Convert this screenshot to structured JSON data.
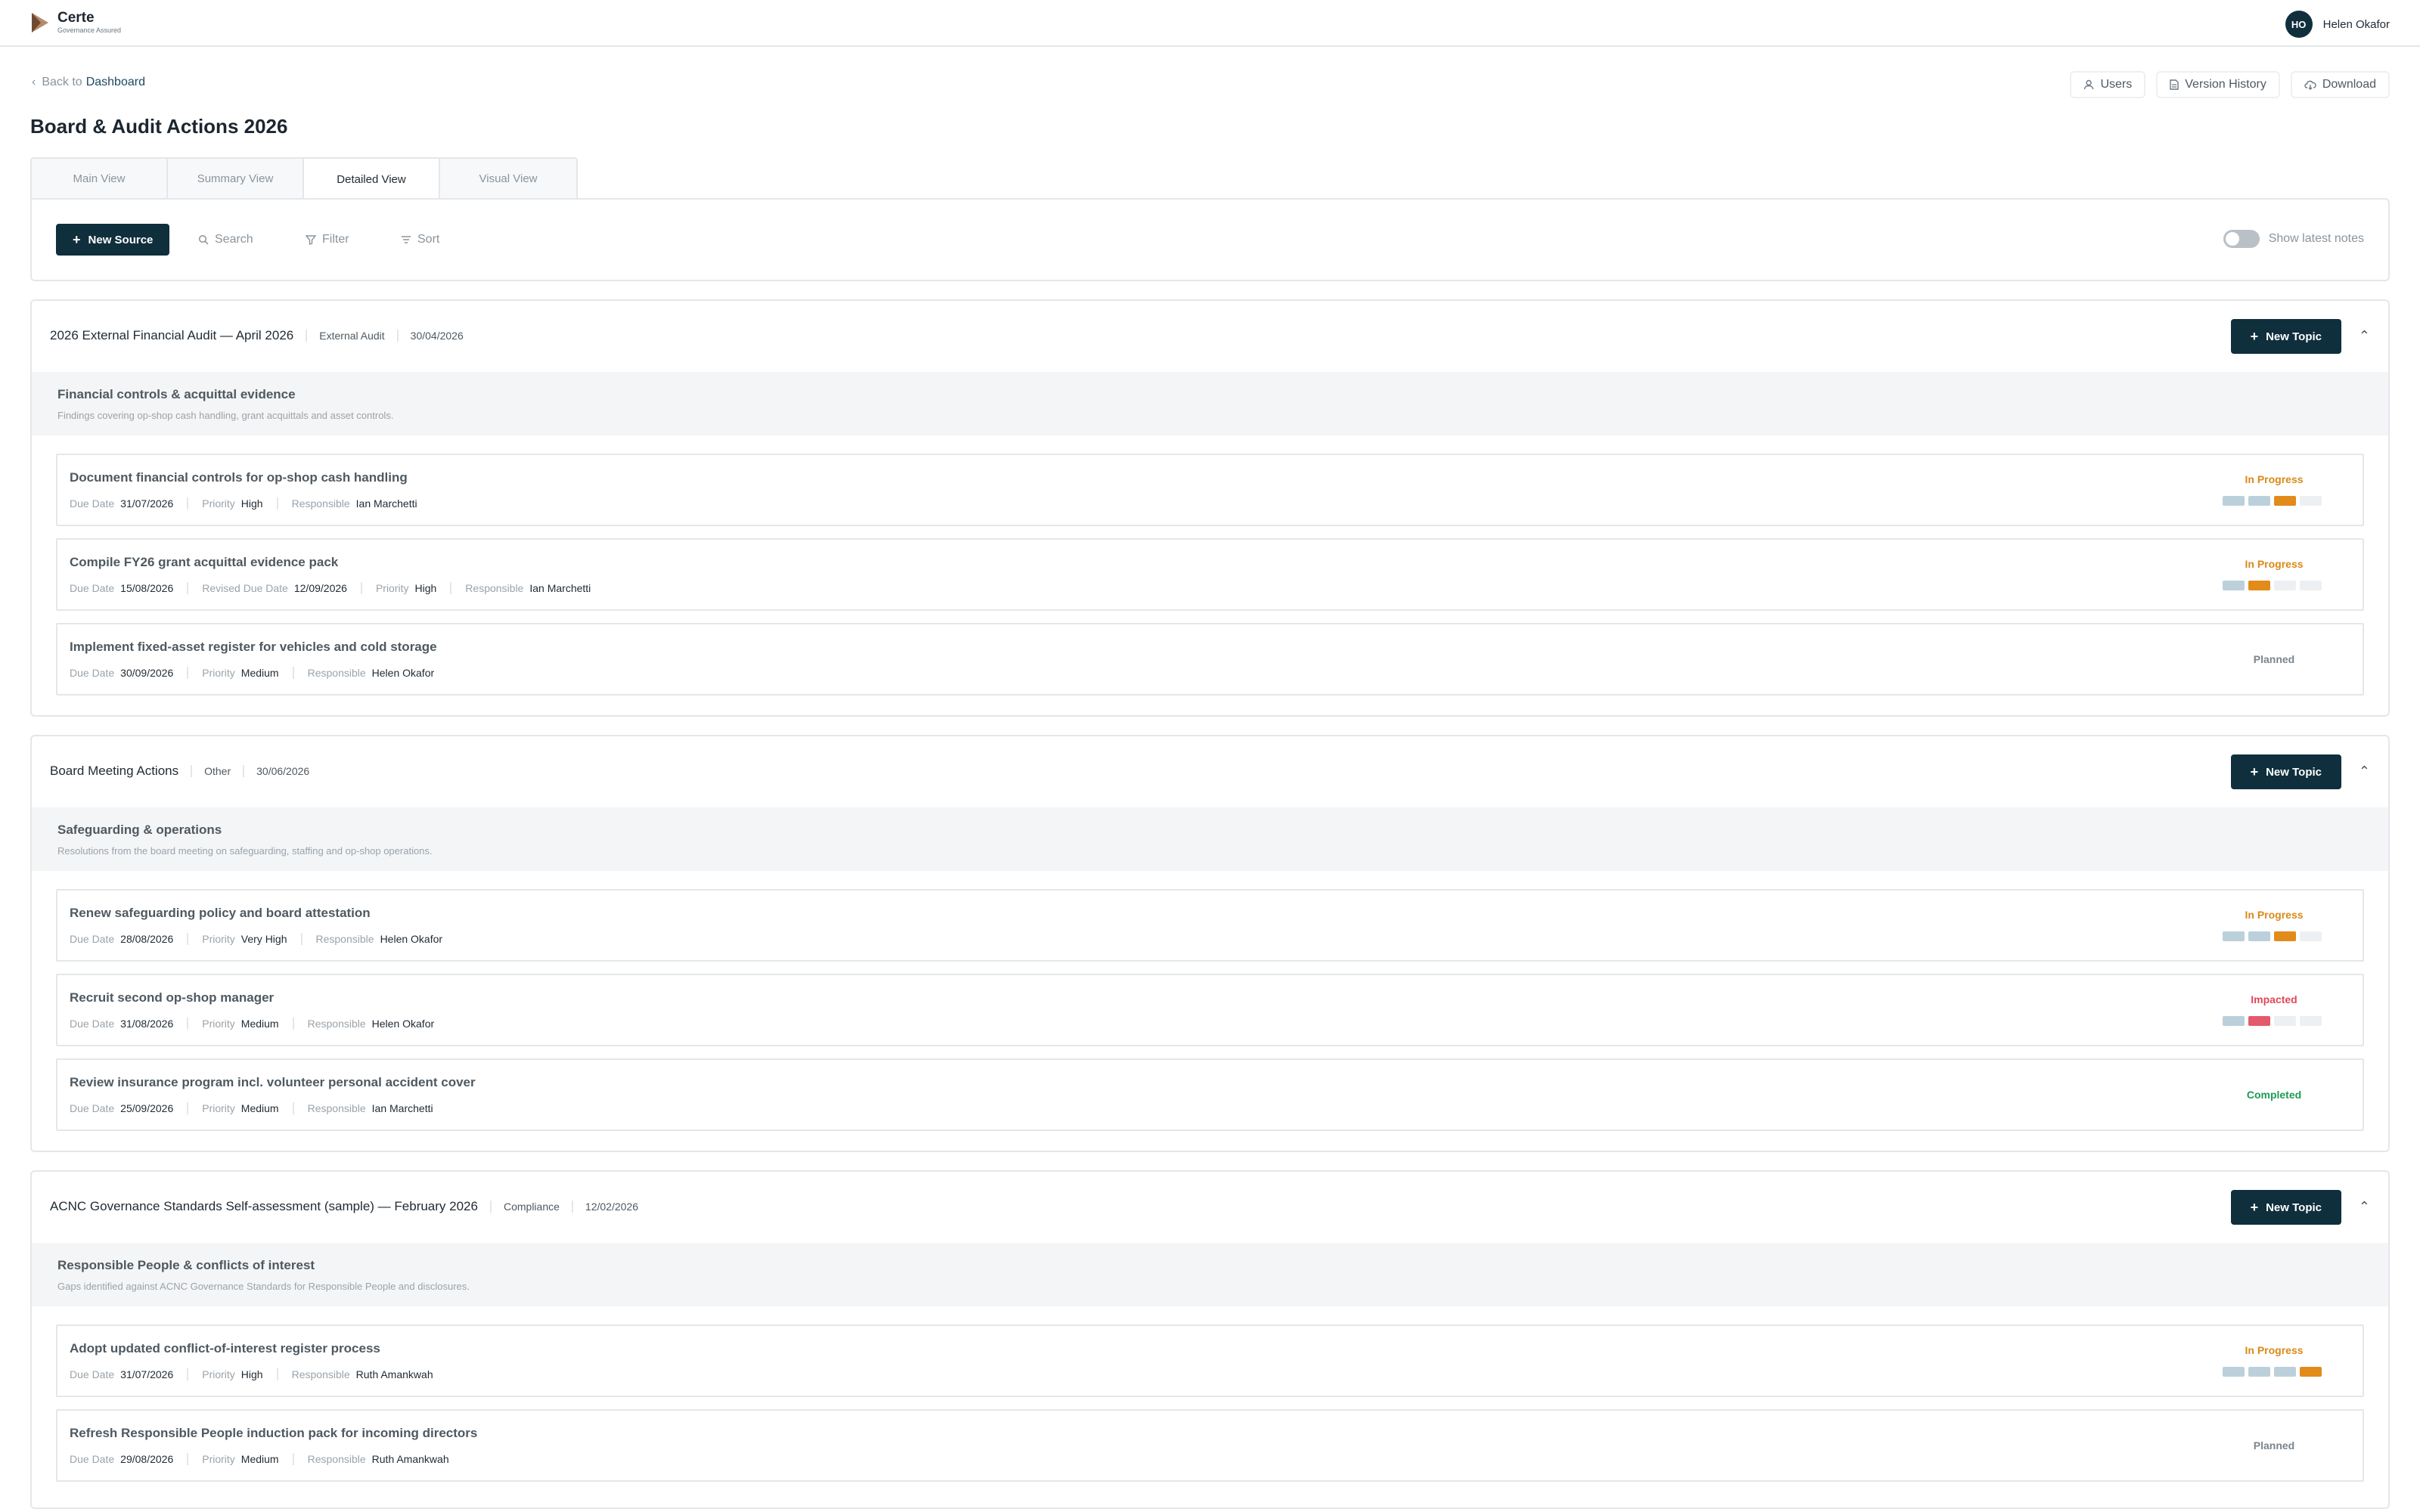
{
  "app": {
    "name": "Certe",
    "tagline": "Governance Assured"
  },
  "user": {
    "initials": "HO",
    "name": "Helen Okafor"
  },
  "nav": {
    "back_prefix": "Back to",
    "back_link": "Dashboard"
  },
  "page_actions": {
    "users": "Users",
    "version_history": "Version History",
    "download": "Download"
  },
  "page_title": "Board & Audit Actions 2026",
  "tabs": [
    {
      "label": "Main View"
    },
    {
      "label": "Summary View"
    },
    {
      "label": "Detailed View"
    },
    {
      "label": "Visual View"
    }
  ],
  "active_tab": "Detailed View",
  "toolbar": {
    "new_source": "New Source",
    "search": "Search",
    "filter": "Filter",
    "sort": "Sort",
    "show_latest_notes": "Show latest notes",
    "show_latest_notes_on": false
  },
  "labels": {
    "due": "Due Date",
    "revised": "Revised Due Date",
    "priority": "Priority",
    "responsible": "Responsible",
    "new_topic": "New Topic"
  },
  "colors": {
    "primary": "#0f2f3c",
    "in_progress": "#d98a19",
    "impacted": "#e0475a",
    "completed": "#1e9b55",
    "planned": "#7a858d"
  },
  "sources": [
    {
      "title": "2026 External Financial Audit — April 2026",
      "type": "External Audit",
      "date": "30/04/2026",
      "topic": {
        "title": "Financial controls & acquittal evidence",
        "description": "Findings covering op-shop cash handling, grant acquittals and asset controls."
      },
      "actions": [
        {
          "title": "Document financial controls for op-shop cash handling",
          "due": "31/07/2026",
          "priority": "High",
          "responsible": "Ian Marchetti",
          "status": "In Progress",
          "progress": [
            "done",
            "done",
            "current",
            "empty"
          ]
        },
        {
          "title": "Compile FY26 grant acquittal evidence pack",
          "due": "15/08/2026",
          "revised": "12/09/2026",
          "priority": "High",
          "responsible": "Ian Marchetti",
          "status": "In Progress",
          "progress": [
            "done",
            "current",
            "empty",
            "empty"
          ]
        },
        {
          "title": "Implement fixed-asset register for vehicles and cold storage",
          "due": "30/09/2026",
          "priority": "Medium",
          "responsible": "Helen Okafor",
          "status": "Planned"
        }
      ]
    },
    {
      "title": "Board Meeting Actions",
      "type": "Other",
      "date": "30/06/2026",
      "topic": {
        "title": "Safeguarding & operations",
        "description": "Resolutions from the board meeting on safeguarding, staffing and op-shop operations."
      },
      "actions": [
        {
          "title": "Renew safeguarding policy and board attestation",
          "due": "28/08/2026",
          "priority": "Very High",
          "responsible": "Helen Okafor",
          "status": "In Progress",
          "progress": [
            "done",
            "done",
            "current",
            "empty"
          ]
        },
        {
          "title": "Recruit second op-shop manager",
          "due": "31/08/2026",
          "priority": "Medium",
          "responsible": "Helen Okafor",
          "status": "Impacted",
          "progress": [
            "done",
            "impacted",
            "empty",
            "empty"
          ]
        },
        {
          "title": "Review insurance program incl. volunteer personal accident cover",
          "due": "25/09/2026",
          "priority": "Medium",
          "responsible": "Ian Marchetti",
          "status": "Completed"
        }
      ]
    },
    {
      "title": "ACNC Governance Standards Self-assessment (sample) — February 2026",
      "type": "Compliance",
      "date": "12/02/2026",
      "topic": {
        "title": "Responsible People & conflicts of interest",
        "description": "Gaps identified against ACNC Governance Standards for Responsible People and disclosures."
      },
      "actions": [
        {
          "title": "Adopt updated conflict-of-interest register process",
          "due": "31/07/2026",
          "priority": "High",
          "responsible": "Ruth Amankwah",
          "status": "In Progress",
          "progress": [
            "done",
            "done",
            "done",
            "current"
          ]
        },
        {
          "title": "Refresh Responsible People induction pack for incoming directors",
          "due": "29/08/2026",
          "priority": "Medium",
          "responsible": "Ruth Amankwah",
          "status": "Planned"
        }
      ]
    }
  ]
}
